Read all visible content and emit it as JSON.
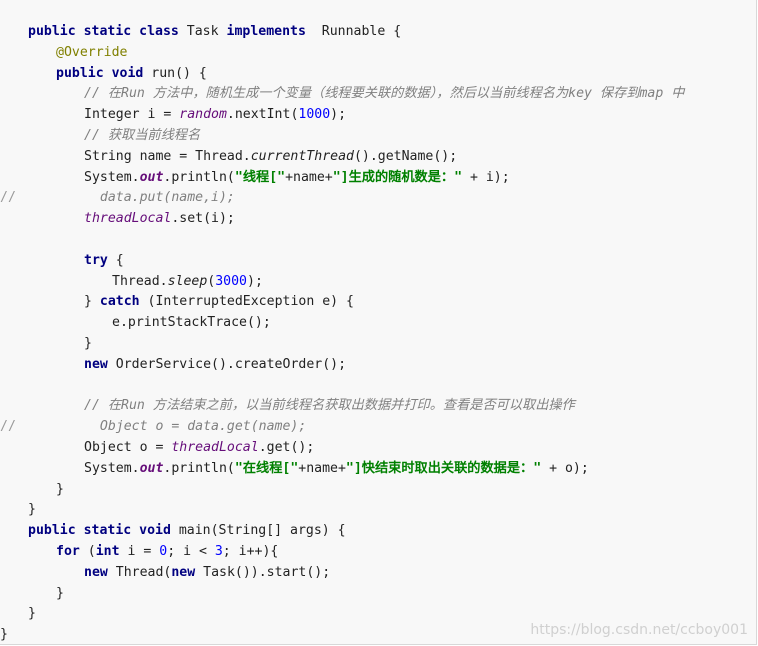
{
  "code": {
    "lines": [
      {
        "indent": 1,
        "tokens": [
          {
            "t": "public static class ",
            "c": "kw"
          },
          {
            "t": "Task ",
            "c": ""
          },
          {
            "t": "implements",
            "c": "kw"
          },
          {
            "t": "  Runnable {",
            "c": ""
          }
        ]
      },
      {
        "indent": 2,
        "tokens": [
          {
            "t": "@Override",
            "c": "an"
          }
        ]
      },
      {
        "indent": 2,
        "tokens": [
          {
            "t": "public void ",
            "c": "kw"
          },
          {
            "t": "run() {",
            "c": ""
          }
        ]
      },
      {
        "indent": 3,
        "tokens": [
          {
            "t": "// 在Run 方法中，随机生成一个变量（线程要关联的数据），然后以当前线程名为key 保存到map 中",
            "c": "com"
          }
        ]
      },
      {
        "indent": 3,
        "tokens": [
          {
            "t": "Integer i = ",
            "c": ""
          },
          {
            "t": "random",
            "c": "fld"
          },
          {
            "t": ".nextInt(",
            "c": ""
          },
          {
            "t": "1000",
            "c": "num"
          },
          {
            "t": ");",
            "c": ""
          }
        ]
      },
      {
        "indent": 3,
        "tokens": [
          {
            "t": "// 获取当前线程名",
            "c": "com"
          }
        ]
      },
      {
        "indent": 3,
        "tokens": [
          {
            "t": "String name = Thread.",
            "c": ""
          },
          {
            "t": "currentThread",
            "c": "it"
          },
          {
            "t": "().getName();",
            "c": ""
          }
        ]
      },
      {
        "indent": 3,
        "tokens": [
          {
            "t": "System.",
            "c": ""
          },
          {
            "t": "out",
            "c": "fldb"
          },
          {
            "t": ".println(",
            "c": ""
          },
          {
            "t": "\"线程[\"",
            "c": "str"
          },
          {
            "t": "+name+",
            "c": ""
          },
          {
            "t": "\"]生成的随机数是：\"",
            "c": "str"
          },
          {
            "t": " + i);",
            "c": ""
          }
        ]
      },
      {
        "indent": 3,
        "comment": "//",
        "tokens": [
          {
            "t": "  data.put(name,i);",
            "c": "com"
          }
        ]
      },
      {
        "indent": 3,
        "tokens": [
          {
            "t": "threadLocal",
            "c": "fld"
          },
          {
            "t": ".set(i);",
            "c": ""
          }
        ]
      },
      {
        "indent": 0,
        "tokens": []
      },
      {
        "indent": 3,
        "tokens": [
          {
            "t": "try",
            "c": "kw"
          },
          {
            "t": " {",
            "c": ""
          }
        ]
      },
      {
        "indent": 4,
        "tokens": [
          {
            "t": "Thread.",
            "c": ""
          },
          {
            "t": "sleep",
            "c": "it"
          },
          {
            "t": "(",
            "c": ""
          },
          {
            "t": "3000",
            "c": "num"
          },
          {
            "t": ");",
            "c": ""
          }
        ]
      },
      {
        "indent": 3,
        "tokens": [
          {
            "t": "} ",
            "c": ""
          },
          {
            "t": "catch",
            "c": "kw"
          },
          {
            "t": " (InterruptedException e) {",
            "c": ""
          }
        ]
      },
      {
        "indent": 4,
        "tokens": [
          {
            "t": "e.printStackTrace();",
            "c": ""
          }
        ]
      },
      {
        "indent": 3,
        "tokens": [
          {
            "t": "}",
            "c": ""
          }
        ]
      },
      {
        "indent": 3,
        "tokens": [
          {
            "t": "new",
            "c": "kw"
          },
          {
            "t": " OrderService().createOrder();",
            "c": ""
          }
        ]
      },
      {
        "indent": 0,
        "tokens": []
      },
      {
        "indent": 3,
        "tokens": [
          {
            "t": "// 在Run 方法结束之前，以当前线程名获取出数据并打印。查看是否可以取出操作",
            "c": "com"
          }
        ]
      },
      {
        "indent": 3,
        "comment": "//",
        "tokens": [
          {
            "t": "  Object o = data.get(name);",
            "c": "com"
          }
        ]
      },
      {
        "indent": 3,
        "tokens": [
          {
            "t": "Object o = ",
            "c": ""
          },
          {
            "t": "threadLocal",
            "c": "fld"
          },
          {
            "t": ".get();",
            "c": ""
          }
        ]
      },
      {
        "indent": 3,
        "tokens": [
          {
            "t": "System.",
            "c": ""
          },
          {
            "t": "out",
            "c": "fldb"
          },
          {
            "t": ".println(",
            "c": ""
          },
          {
            "t": "\"在线程[\"",
            "c": "str"
          },
          {
            "t": "+name+",
            "c": ""
          },
          {
            "t": "\"]快结束时取出关联的数据是：\"",
            "c": "str"
          },
          {
            "t": " + o);",
            "c": ""
          }
        ]
      },
      {
        "indent": 2,
        "tokens": [
          {
            "t": "}",
            "c": ""
          }
        ]
      },
      {
        "indent": 1,
        "tokens": [
          {
            "t": "}",
            "c": ""
          }
        ]
      },
      {
        "indent": 1,
        "tokens": [
          {
            "t": "public static void ",
            "c": "kw"
          },
          {
            "t": "main(String[] args) {",
            "c": ""
          }
        ]
      },
      {
        "indent": 2,
        "tokens": [
          {
            "t": "for",
            "c": "kw"
          },
          {
            "t": " (",
            "c": ""
          },
          {
            "t": "int",
            "c": "kw"
          },
          {
            "t": " i = ",
            "c": ""
          },
          {
            "t": "0",
            "c": "num"
          },
          {
            "t": "; i < ",
            "c": ""
          },
          {
            "t": "3",
            "c": "num"
          },
          {
            "t": "; i++){",
            "c": ""
          }
        ]
      },
      {
        "indent": 3,
        "tokens": [
          {
            "t": "new",
            "c": "kw"
          },
          {
            "t": " Thread(",
            "c": ""
          },
          {
            "t": "new",
            "c": "kw"
          },
          {
            "t": " Task()).start();",
            "c": ""
          }
        ]
      },
      {
        "indent": 2,
        "tokens": [
          {
            "t": "}",
            "c": ""
          }
        ]
      },
      {
        "indent": 1,
        "tokens": [
          {
            "t": "}",
            "c": ""
          }
        ]
      },
      {
        "indent": 0,
        "tokens": [
          {
            "t": "}",
            "c": ""
          }
        ]
      }
    ]
  },
  "watermark": "https://blog.csdn.net/ccboy001"
}
